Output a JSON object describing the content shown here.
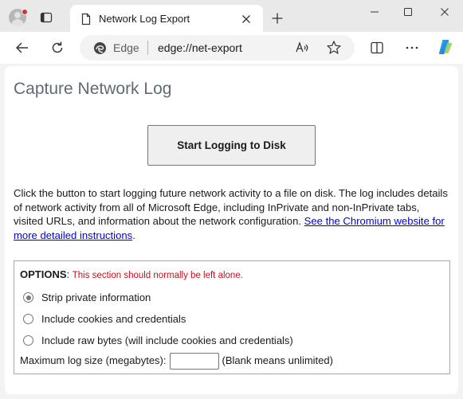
{
  "browser": {
    "tab_title": "Network Log Export",
    "address_scheme_label": "Edge",
    "address_url": "edge://net-export"
  },
  "page": {
    "title": "Capture Network Log",
    "start_button_label": "Start Logging to Disk",
    "description": "Click the button to start logging future network activity to a file on disk. The log includes details of network activity from all of Microsoft Edge, including InPrivate and non-InPrivate tabs, visited URLs, and information about the network configuration.",
    "description_link": "See the Chromium website for more detailed instructions",
    "description_end": "."
  },
  "options": {
    "label": "OPTIONS",
    "label_colon": ":",
    "warning": "This section should normally be left alone.",
    "radios": [
      {
        "label": "Strip private information",
        "checked": true
      },
      {
        "label": "Include cookies and credentials",
        "checked": false
      },
      {
        "label": "Include raw bytes (will include cookies and credentials)",
        "checked": false
      }
    ],
    "max_size_label": "Maximum log size (megabytes):",
    "max_size_value": "",
    "max_size_hint": "(Blank means unlimited)"
  },
  "colors": {
    "title": "#5f6b78",
    "link": "#0000ee",
    "warning": "#c50f1f",
    "profile_dot": "#d13438"
  },
  "icons": [
    "profile-icon",
    "tab-actions-icon",
    "page-icon",
    "close-icon",
    "new-tab-icon",
    "minimize-icon",
    "maximize-icon",
    "window-close-icon",
    "back-icon",
    "refresh-icon",
    "edge-logo-icon",
    "read-aloud-icon",
    "favorite-icon",
    "split-screen-icon",
    "more-icon",
    "copilot-icon"
  ]
}
